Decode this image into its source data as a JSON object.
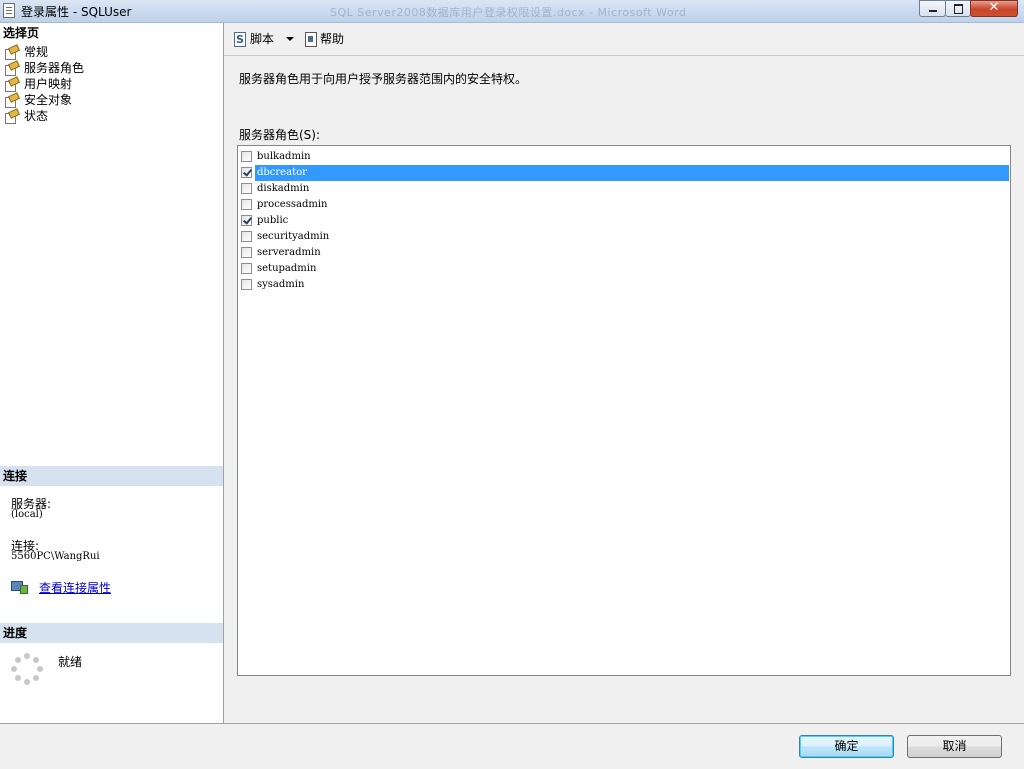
{
  "window": {
    "title": "登录属性 - SQLUser",
    "background_title": "SQL Server2008数据库用户登录权限设置.docx - Microsoft Word"
  },
  "left_pane": {
    "select_page_header": "选择页",
    "pages": [
      {
        "label": "常规",
        "selected": false
      },
      {
        "label": "服务器角色",
        "selected": true
      },
      {
        "label": "用户映射",
        "selected": false
      },
      {
        "label": "安全对象",
        "selected": false
      },
      {
        "label": "状态",
        "selected": false
      }
    ],
    "connection_header": "连接",
    "server_label": "服务器:",
    "server_value": "(local)",
    "connection_label": "连接:",
    "connection_value": "5560PC\\WangRui",
    "view_connection_link": "查看连接属性",
    "progress_header": "进度",
    "progress_status": "就绪"
  },
  "toolbar": {
    "script_label": "脚本",
    "help_label": "帮助"
  },
  "content": {
    "description": "服务器角色用于向用户授予服务器范围内的安全特权。",
    "roles_label": "服务器角色(S):",
    "roles": [
      {
        "name": "bulkadmin",
        "checked": false,
        "selected": false
      },
      {
        "name": "dbcreator",
        "checked": true,
        "selected": true
      },
      {
        "name": "diskadmin",
        "checked": false,
        "selected": false
      },
      {
        "name": "processadmin",
        "checked": false,
        "selected": false
      },
      {
        "name": "public",
        "checked": true,
        "selected": false
      },
      {
        "name": "securityadmin",
        "checked": false,
        "selected": false
      },
      {
        "name": "serveradmin",
        "checked": false,
        "selected": false
      },
      {
        "name": "setupadmin",
        "checked": false,
        "selected": false
      },
      {
        "name": "sysadmin",
        "checked": false,
        "selected": false
      }
    ]
  },
  "buttons": {
    "ok": "确定",
    "cancel": "取消"
  },
  "colors": {
    "selection": "#3399ff",
    "section_header": "#d6e2ef",
    "link": "#0000cc"
  },
  "icons": {
    "page": "page-settings-icon",
    "script": "script-icon",
    "help": "help-icon",
    "connection": "connection-properties-icon",
    "progress": "progress-spinner-icon"
  }
}
